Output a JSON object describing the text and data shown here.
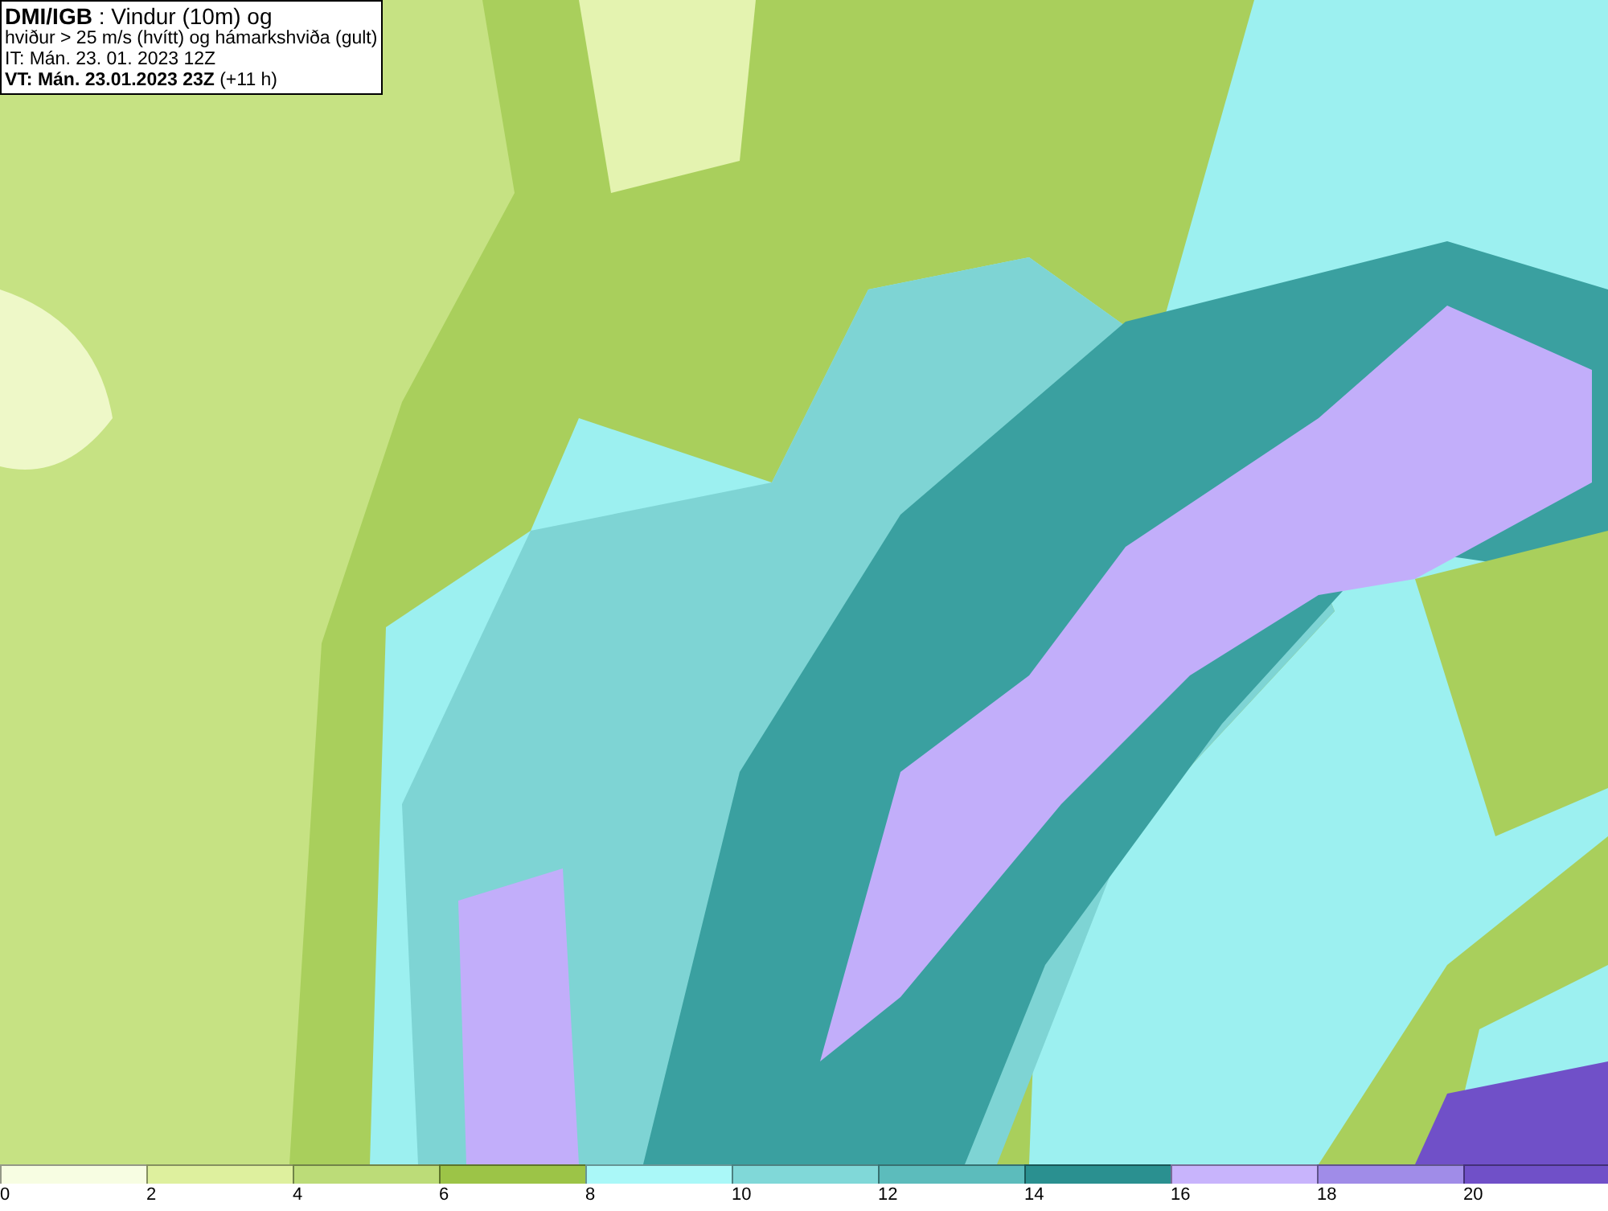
{
  "header": {
    "lines": [
      "**DMI/IGB** : Vindur (10m) og",
      "hviður > 25 m/s (hvítt) og hámarkshviða (gult)",
      "IT: Mán. 23. 01. 2023 12Z",
      "**VT: Mán. 23.01.2023 23Z** (+11 h)"
    ]
  },
  "legend": [
    {
      "label": "0",
      "color": "#f7fde2"
    },
    {
      "label": "2",
      "color": "#def09e"
    },
    {
      "label": "4",
      "color": "#bcdc78"
    },
    {
      "label": "6",
      "color": "#9cc447"
    },
    {
      "label": "8",
      "color": "#aaf8f8"
    },
    {
      "label": "10",
      "color": "#80d8d8"
    },
    {
      "label": "12",
      "color": "#5cbcbc"
    },
    {
      "label": "14",
      "color": "#2a9090"
    },
    {
      "label": "16",
      "color": "#c8b4fc"
    },
    {
      "label": "18",
      "color": "#a08ce8"
    },
    {
      "label": "20",
      "color": "#7050c8"
    }
  ]
}
